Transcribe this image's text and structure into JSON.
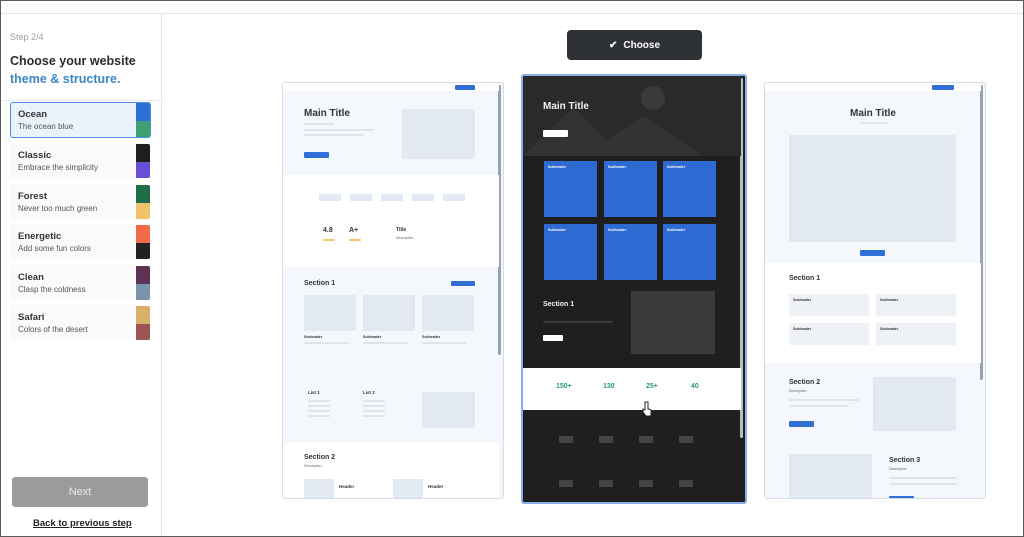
{
  "sidebar": {
    "step": "Step 2/4",
    "title_line1": "Choose your website",
    "title_line2": "theme & structure.",
    "themes": [
      {
        "name": "Ocean",
        "desc": "The ocean blue",
        "colors": [
          "#2f6fd6",
          "#3e9f72"
        ],
        "selected": true
      },
      {
        "name": "Classic",
        "desc": "Embrace the simplicity",
        "colors": [
          "#1e1e1e",
          "#6a4fd6"
        ]
      },
      {
        "name": "Forest",
        "desc": "Never too much green",
        "colors": [
          "#1f6b4a",
          "#f0c46a"
        ]
      },
      {
        "name": "Energetic",
        "desc": "Add some fun colors",
        "colors": [
          "#ef6b4a",
          "#222222"
        ]
      },
      {
        "name": "Clean",
        "desc": "Clasp the coldness",
        "colors": [
          "#5c3354",
          "#7c93ad"
        ]
      },
      {
        "name": "Safari",
        "desc": "Colors of the desert",
        "colors": [
          "#d8b06a",
          "#9a5452"
        ]
      }
    ],
    "next_label": "Next",
    "back_label": "Back to previous step"
  },
  "main": {
    "choose_label": "Choose",
    "templates": {
      "left": {
        "main_title": "Main Title",
        "stat1": "4.8",
        "stat2": "A+",
        "stat3": "Title",
        "stat3_sub": "Description",
        "section1": "Section 1",
        "subheader": "Subheader",
        "list1": "List 1",
        "list2": "List 2",
        "section2": "Section 2",
        "section2_desc": "Description",
        "header": "Header"
      },
      "middle": {
        "main_title": "Main Title",
        "subheader": "Subheader",
        "section1": "Section 1",
        "stats": [
          "150+",
          "130",
          "25+",
          "40"
        ]
      },
      "right": {
        "main_title": "Main Title",
        "section1": "Section 1",
        "subheader": "Subheader",
        "section2": "Section 2",
        "section3": "Section 3",
        "description": "Description"
      }
    }
  }
}
